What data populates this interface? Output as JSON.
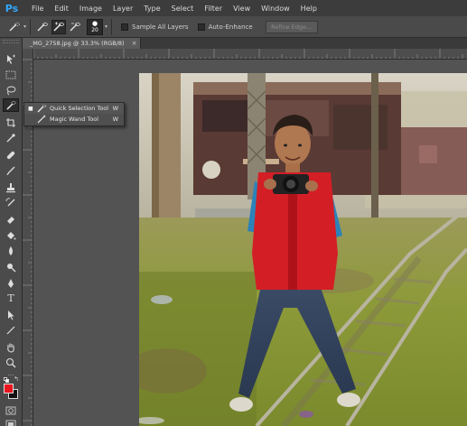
{
  "app": {
    "logo_text": "Ps"
  },
  "menu": [
    "File",
    "Edit",
    "Image",
    "Layer",
    "Type",
    "Select",
    "Filter",
    "View",
    "Window",
    "Help"
  ],
  "options": {
    "brush_size": "20",
    "sample_all_layers": "Sample All Layers",
    "auto_enhance": "Auto-Enhance",
    "refine_edge": "Refine Edge..."
  },
  "document": {
    "tab_title": "_MG_2758.jpg @ 33.3% (RGB/8)",
    "close_glyph": "×"
  },
  "flyout": {
    "items": [
      {
        "label": "Quick Selection Tool",
        "shortcut": "W",
        "active": true
      },
      {
        "label": "Magic Wand Tool",
        "shortcut": "W",
        "active": false
      }
    ]
  },
  "colors": {
    "foreground": "#e8161e",
    "background": "#111111",
    "accent": "#31a8ff"
  },
  "tools": [
    "move-tool",
    "marquee-tool",
    "lasso-tool",
    "quick-selection-tool",
    "crop-tool",
    "eyedropper-tool",
    "spot-healing-tool",
    "brush-tool",
    "clone-stamp-tool",
    "history-brush-tool",
    "eraser-tool",
    "gradient-tool",
    "blur-tool",
    "dodge-tool",
    "pen-tool",
    "type-tool",
    "path-selection-tool",
    "shape-tool",
    "hand-tool",
    "zoom-tool"
  ]
}
